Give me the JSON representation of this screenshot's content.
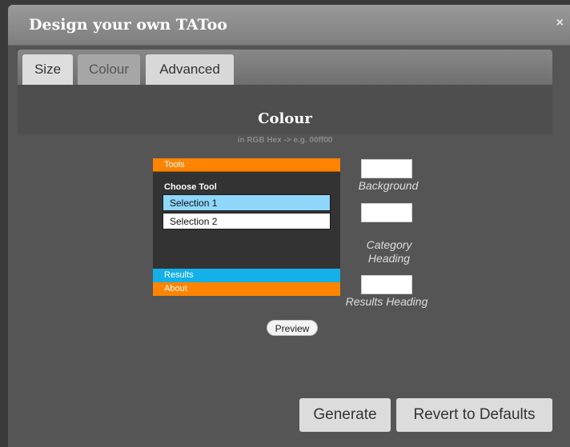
{
  "dialog": {
    "title": "Design your own TAToo",
    "close_glyph": "×"
  },
  "tabs": [
    {
      "label": "Size",
      "active": false
    },
    {
      "label": "Colour",
      "active": true
    },
    {
      "label": "Advanced",
      "active": false
    }
  ],
  "section": {
    "title": "Colour",
    "subtitle": "in RGB Hex -> e.g. 00ff00"
  },
  "preview": {
    "tools_label": "Tools",
    "choose_tool_label": "Choose Tool",
    "selections": [
      "Selection 1",
      "Selection 2"
    ],
    "results_label": "Results",
    "about_label": "About",
    "button_label": "Preview"
  },
  "color_fields": [
    {
      "label": "Background",
      "value": ""
    },
    {
      "label": "Category Heading",
      "value": ""
    },
    {
      "label": "Results Heading",
      "value": ""
    }
  ],
  "actions": {
    "generate_label": "Generate",
    "revert_label": "Revert to Defaults"
  },
  "colors": {
    "accent_orange": "#ff8400",
    "accent_blue": "#14b0e8",
    "selection_highlight": "#8fd6fb"
  }
}
